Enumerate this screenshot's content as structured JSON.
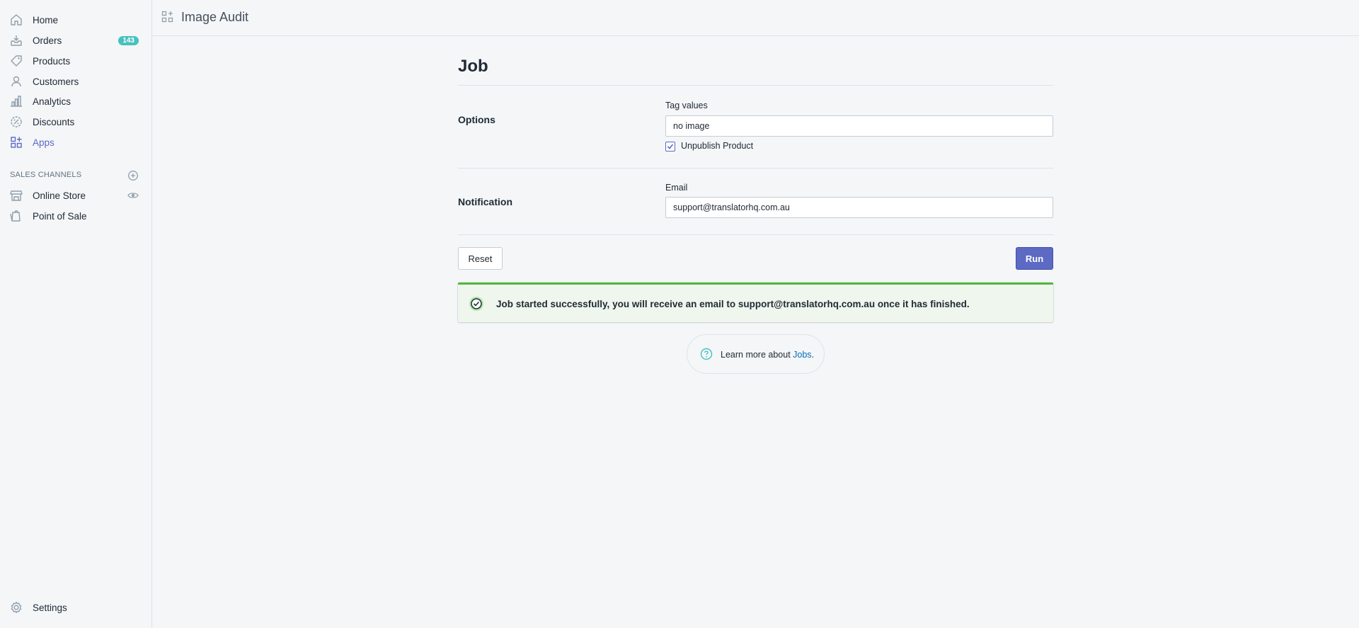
{
  "sidebar": {
    "items": [
      {
        "label": "Home",
        "icon": "home-icon"
      },
      {
        "label": "Orders",
        "icon": "orders-icon",
        "badge": "143"
      },
      {
        "label": "Products",
        "icon": "tag-icon"
      },
      {
        "label": "Customers",
        "icon": "person-icon"
      },
      {
        "label": "Analytics",
        "icon": "bar-chart-icon"
      },
      {
        "label": "Discounts",
        "icon": "discount-icon"
      },
      {
        "label": "Apps",
        "icon": "apps-icon",
        "active": true
      }
    ],
    "sales_channels_heading": "SALES CHANNELS",
    "channels": [
      {
        "label": "Online Store",
        "icon": "store-icon"
      },
      {
        "label": "Point of Sale",
        "icon": "pos-icon"
      }
    ],
    "settings_label": "Settings"
  },
  "topbar": {
    "title": "Image Audit"
  },
  "main": {
    "page_title": "Job",
    "options": {
      "section_label": "Options",
      "tag_values_label": "Tag values",
      "tag_values_value": "no image",
      "unpublish_label": "Unpublish Product",
      "unpublish_checked": true
    },
    "notification": {
      "section_label": "Notification",
      "email_label": "Email",
      "email_value": "support@translatorhq.com.au"
    },
    "reset_label": "Reset",
    "run_label": "Run",
    "banner_message": "Job started successfully, you will receive an email to support@translatorhq.com.au once it has finished.",
    "help": {
      "prefix": "Learn more about ",
      "link": "Jobs",
      "suffix": "."
    }
  },
  "colors": {
    "accent": "#5c6ac4",
    "badge": "#47c1bf",
    "success": "#50b83c",
    "link": "#006fbb"
  }
}
